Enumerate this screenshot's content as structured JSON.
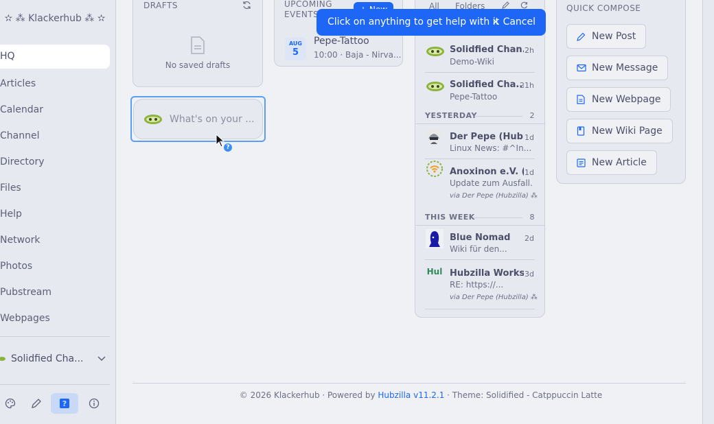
{
  "brand": "✫ ⁂ Klackerhub ⁂ ✫",
  "nav": [
    "HQ",
    "Articles",
    "Calendar",
    "Channel",
    "Directory",
    "Files",
    "Help",
    "Network",
    "Photos",
    "Pubstream",
    "Webpages"
  ],
  "channel": {
    "name": "Solidfied Cha...",
    "chevron": "⌄"
  },
  "drafts": {
    "header": "DRAFTS",
    "empty": "No saved drafts"
  },
  "composer": {
    "placeholder": "What's on your ..."
  },
  "events": {
    "header_line1": "UPCOMING",
    "header_line2": "EVENTS",
    "new_label": "+ New",
    "items": [
      {
        "month": "AUG",
        "day": "5",
        "title": "Pepe-Tattoo",
        "sub": "10:00 · Baja - Nirva..."
      }
    ]
  },
  "notifications": {
    "tabs": [
      "All",
      "Folders"
    ],
    "items": [
      {
        "name": "Solidfied Chan...",
        "time": "2h",
        "sub": "Demo-Wiki",
        "via": ""
      },
      {
        "name": "Solidfied Cha...",
        "time": "21h",
        "sub": "Pepe-Tattoo",
        "via": ""
      },
      {
        "name": "Der Pepe (Hub...",
        "time": "1d",
        "sub": "Linux News: #^In...",
        "via": ""
      },
      {
        "name": "Anoxinon e.V. (...",
        "time": "1d",
        "sub": "Update zum Ausfall...",
        "via": "via Der Pepe (Hubzilla) ⁂"
      },
      {
        "name": "Blue Nomad",
        "time": "2d",
        "sub": "Wiki für den...",
        "via": ""
      },
      {
        "name": "Hubzilla Works...",
        "time": "3d",
        "sub": "RE: https://...",
        "via": "via Der Pepe (Hubzilla) ⁂"
      }
    ],
    "groups": [
      {
        "label": "YESTERDAY",
        "count": "2"
      },
      {
        "label": "THIS WEEK",
        "count": "8"
      }
    ],
    "hub_abbrev": "Hul"
  },
  "quick_compose": {
    "header": "QUICK COMPOSE",
    "buttons": [
      "New Post",
      "New Message",
      "New Webpage",
      "New Wiki Page",
      "New Article"
    ]
  },
  "toast": {
    "message": "Click on anything to get help with it",
    "cancel": "× Cancel"
  },
  "footer": {
    "prefix": "© 2026 Klackerhub · Powered by ",
    "link": "Hubzilla v11.2.1",
    "suffix": " · Theme: Solidified - Catppuccin Latte"
  },
  "colors": {
    "accent": "#1e66f5",
    "background": "#eff1f5",
    "card": "#e6e9ef"
  }
}
